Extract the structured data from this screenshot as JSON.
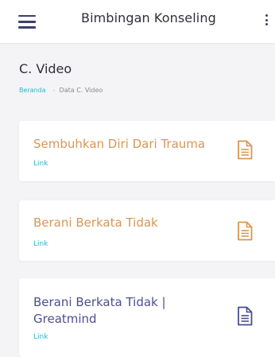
{
  "appbar": {
    "title": "Bimbingan Konseling",
    "menu_icon": "hamburger-menu-icon",
    "more_icon": "vertical-dots-icon"
  },
  "page": {
    "title": "C. Video",
    "breadcrumb": {
      "home": "Beranda",
      "separator": "-",
      "current": "Data C. Video"
    }
  },
  "videos": [
    {
      "title": "Sembuhkan Diri Dari Trauma",
      "link_label": "Link",
      "icon": "document-icon",
      "color": "#d69756"
    },
    {
      "title": "Berani Berkata Tidak",
      "link_label": "Link",
      "icon": "document-icon",
      "color": "#d69756"
    },
    {
      "title": "Berani Berkata Tidak | Greatmind",
      "link_label": "Link",
      "icon": "document-icon",
      "color": "#4b4f8c"
    }
  ],
  "colors": {
    "accent_orange": "#d69756",
    "accent_indigo": "#4b4f8c",
    "link_teal": "#2fb5c3",
    "background": "#f4f4f6"
  }
}
